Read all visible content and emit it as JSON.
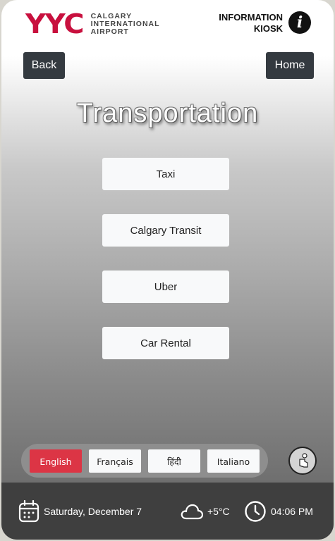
{
  "header": {
    "logo_mark": "YYC",
    "logo_lines": [
      "CALGARY",
      "INTERNATIONAL",
      "AIRPORT"
    ],
    "info_line1": "INFORMATION",
    "info_line2": "KIOSK",
    "info_icon": "info-icon"
  },
  "nav": {
    "back_label": "Back",
    "home_label": "Home"
  },
  "main": {
    "title": "Transportation",
    "options": [
      {
        "label": "Taxi"
      },
      {
        "label": "Calgary Transit"
      },
      {
        "label": "Uber"
      },
      {
        "label": "Car Rental"
      }
    ]
  },
  "languages": {
    "items": [
      {
        "label": "English",
        "active": true
      },
      {
        "label": "Français",
        "active": false
      },
      {
        "label": "हिंदी",
        "active": false
      },
      {
        "label": "Italiano",
        "active": false
      }
    ],
    "active_color": "#dc3545"
  },
  "accessibility": {
    "icon": "accessibility-icon"
  },
  "footer": {
    "date": "Saturday, December 7",
    "date_icon": "calendar-icon",
    "weather": "+5°C",
    "weather_icon": "cloud-icon",
    "time": "04:06 PM",
    "time_icon": "clock-icon"
  },
  "colors": {
    "brand": "#c8103e",
    "nav_button": "#343a40",
    "footer_bg": "#3f3f3f"
  }
}
